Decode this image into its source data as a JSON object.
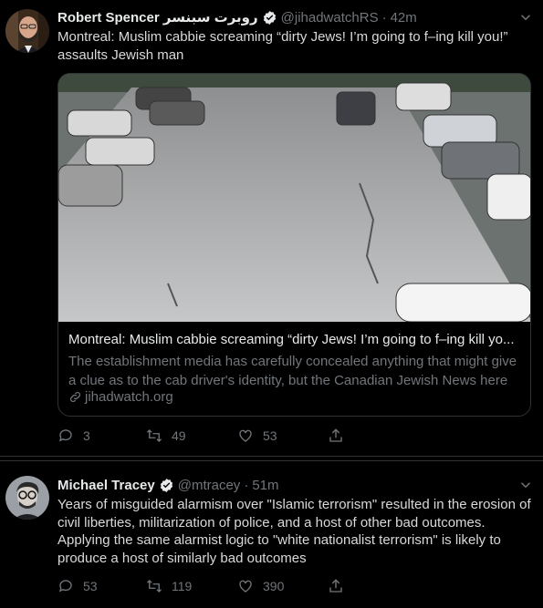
{
  "colors": {
    "background": "#000000",
    "text": "#d9d9d9",
    "muted": "#71767b",
    "border": "#2f3336",
    "verified": "#e7e9ea"
  },
  "tweets": [
    {
      "author_name": "Robert Spencer روبرت سبنسر",
      "handle": "@jihadwatchRS",
      "separator": "·",
      "time": "42m",
      "text": "Montreal: Muslim cabbie screaming “dirty Jews! I’m going to f–ing kill you!” assaults Jewish man",
      "card": {
        "title": "Montreal: Muslim cabbie screaming “dirty Jews! I’m going to f–ing kill yo...",
        "description": "The establishment media has carefully concealed anything that might give a clue as to the cab driver's identity, but the Canadian Jewish News here",
        "domain": "jihadwatch.org"
      },
      "replies": "3",
      "retweets": "49",
      "likes": "53"
    },
    {
      "author_name": "Michael Tracey",
      "handle": "@mtracey",
      "separator": "·",
      "time": "51m",
      "text": "Years of misguided alarmism over \"Islamic terrorism\" resulted in the erosion of civil liberties, militarization of police, and a host of other bad outcomes. Applying the same alarmist logic to \"white nationalist terrorism\" is likely to produce a host of similarly bad outcomes",
      "replies": "53",
      "retweets": "119",
      "likes": "390"
    }
  ],
  "icons": [
    "avatar",
    "verified-badge-icon",
    "chevron-down-icon",
    "reply-icon",
    "retweet-icon",
    "like-icon",
    "share-icon",
    "link-icon"
  ]
}
